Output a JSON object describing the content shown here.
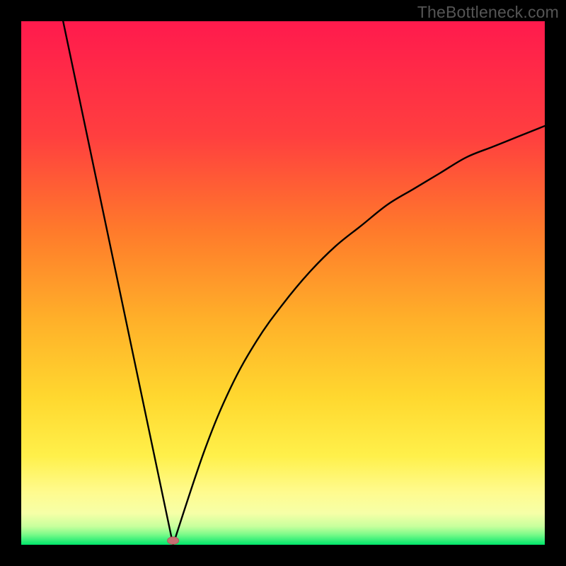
{
  "watermark": "TheBottleneck.com",
  "colors": {
    "page_bg": "#000000",
    "gradient_top": "#ff1a4d",
    "gradient_mid1": "#ff6a2b",
    "gradient_mid2": "#ffb029",
    "gradient_mid3": "#ffe23a",
    "gradient_mid4": "#fff980",
    "gradient_bottom": "#00e66b",
    "curve": "#000000",
    "marker_fill": "#c76e72",
    "marker_stroke": "#b05a5e"
  },
  "chart_data": {
    "type": "line",
    "title": "",
    "xlabel": "",
    "ylabel": "",
    "xlim": [
      0,
      100
    ],
    "ylim": [
      0,
      100
    ],
    "note": "V-shaped absolute-value style curve with asymmetric right branch (concave), minimum near x≈29 at y≈0; left branch reaches y≈100 at x≈8; right branch reaches y≈80 at x=100.",
    "left_branch": {
      "x": [
        8,
        29
      ],
      "y": [
        100,
        0
      ]
    },
    "right_branch_samples": {
      "x": [
        29,
        35,
        40,
        45,
        50,
        55,
        60,
        65,
        70,
        75,
        80,
        85,
        90,
        95,
        100
      ],
      "y": [
        0,
        18,
        30,
        39,
        46,
        52,
        57,
        61,
        65,
        68,
        71,
        74,
        76,
        78,
        80
      ]
    },
    "marker": {
      "x": 29,
      "y": 0.8,
      "shape": "pill"
    }
  }
}
